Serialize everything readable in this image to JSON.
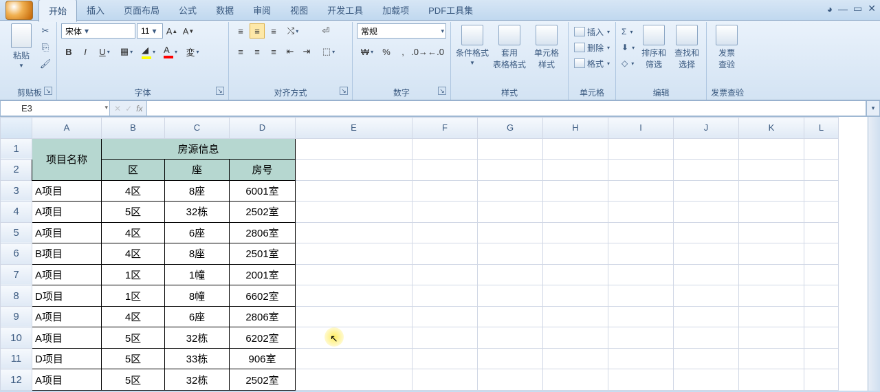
{
  "tabs": {
    "active": "开始",
    "items": [
      "开始",
      "插入",
      "页面布局",
      "公式",
      "数据",
      "审阅",
      "视图",
      "开发工具",
      "加载项",
      "PDF工具集"
    ]
  },
  "ribbon": {
    "clipboard": {
      "paste": "粘贴",
      "label": "剪贴板"
    },
    "font": {
      "name": "宋体",
      "size": "11",
      "label": "字体",
      "bold": "B",
      "italic": "I",
      "underline": "U"
    },
    "alignment": {
      "label": "对齐方式"
    },
    "number": {
      "format": "常规",
      "label": "数字"
    },
    "styles": {
      "cond": "条件格式",
      "table": "套用\n表格格式",
      "cell": "单元格\n样式",
      "label": "样式"
    },
    "cells": {
      "insert": "插入",
      "delete": "删除",
      "format": "格式",
      "label": "单元格"
    },
    "editing": {
      "sort": "排序和\n筛选",
      "find": "查找和\n选择",
      "label": "编辑"
    },
    "invoice": {
      "check": "发票\n查验",
      "label": "发票查验"
    }
  },
  "namebox": "E3",
  "formula": "",
  "columns": [
    "A",
    "B",
    "C",
    "D",
    "E",
    "F",
    "G",
    "H",
    "I",
    "J",
    "K",
    "L"
  ],
  "header1": {
    "project": "项目名称",
    "info": "房源信息"
  },
  "header2": {
    "zone": "区",
    "building": "座",
    "room": "房号"
  },
  "rows": [
    {
      "n": "3",
      "p": "A项目",
      "z": "4区",
      "b": "8座",
      "r": "6001室"
    },
    {
      "n": "4",
      "p": "A项目",
      "z": "5区",
      "b": "32栋",
      "r": "2502室"
    },
    {
      "n": "5",
      "p": "A项目",
      "z": "4区",
      "b": "6座",
      "r": "2806室"
    },
    {
      "n": "6",
      "p": "B项目",
      "z": "4区",
      "b": "8座",
      "r": "2501室"
    },
    {
      "n": "7",
      "p": "A项目",
      "z": "1区",
      "b": "1幢",
      "r": "2001室"
    },
    {
      "n": "8",
      "p": "D项目",
      "z": "1区",
      "b": "8幢",
      "r": "6602室"
    },
    {
      "n": "9",
      "p": "A项目",
      "z": "4区",
      "b": "6座",
      "r": "2806室"
    },
    {
      "n": "10",
      "p": "A项目",
      "z": "5区",
      "b": "32栋",
      "r": "6202室"
    },
    {
      "n": "11",
      "p": "D项目",
      "z": "5区",
      "b": "33栋",
      "r": "906室"
    },
    {
      "n": "12",
      "p": "A项目",
      "z": "5区",
      "b": "32栋",
      "r": "2502室"
    }
  ]
}
